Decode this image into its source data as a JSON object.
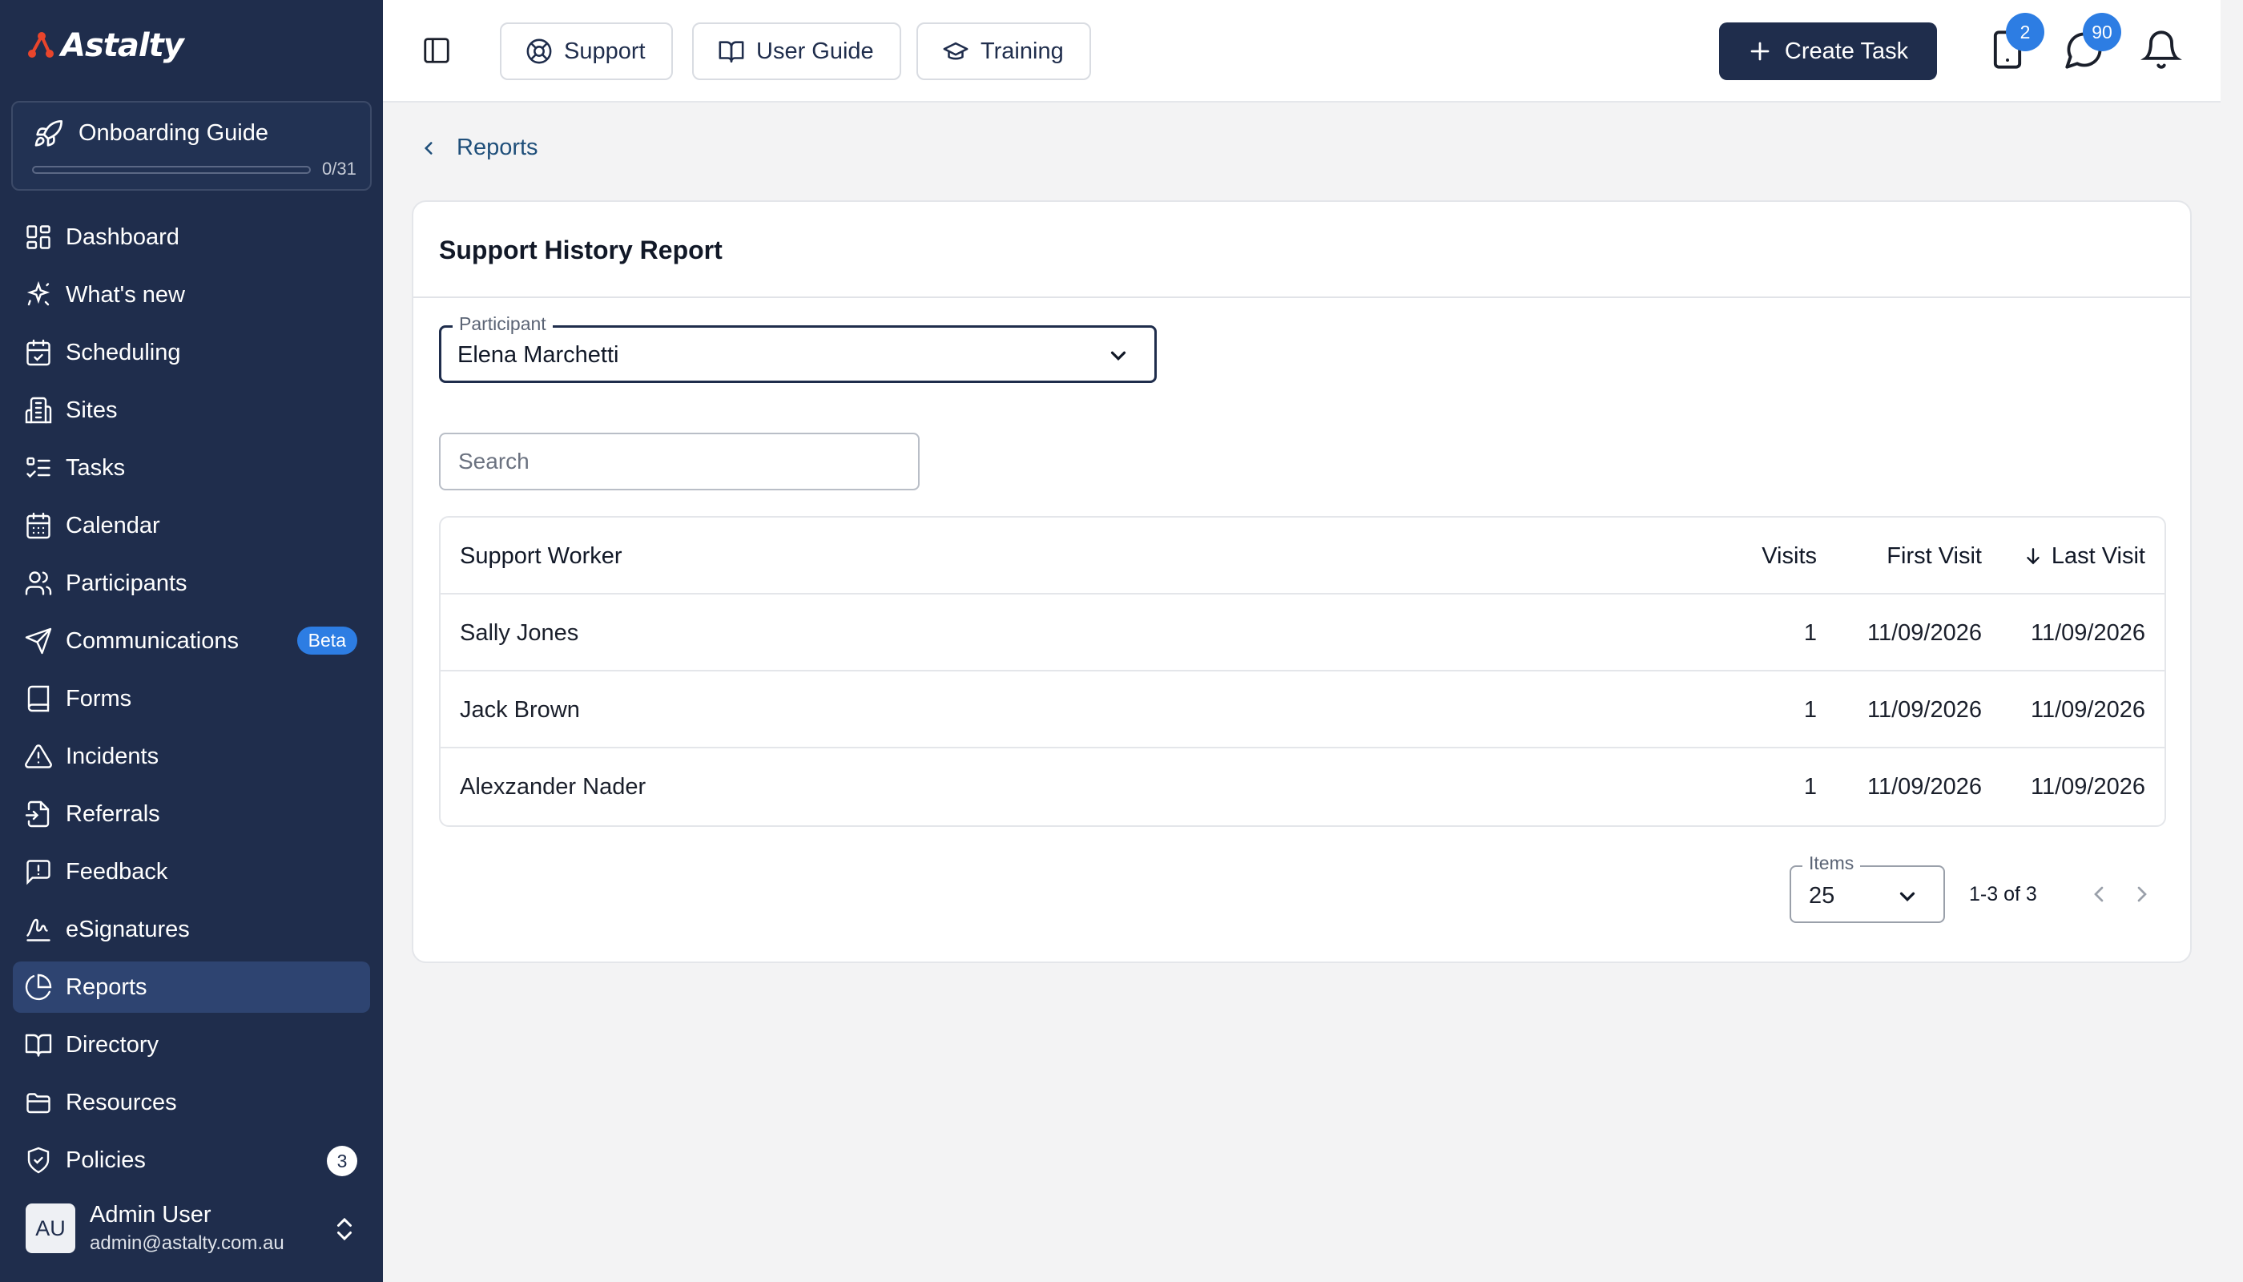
{
  "app": {
    "logo_text": "Astalty"
  },
  "onboarding": {
    "title": "Onboarding Guide",
    "progress_text": "0/31",
    "progress": 0
  },
  "sidebar": {
    "items": [
      {
        "label": "Dashboard",
        "icon": "dashboard-icon"
      },
      {
        "label": "What's new",
        "icon": "sparkle-icon"
      },
      {
        "label": "Scheduling",
        "icon": "calendar-check-icon"
      },
      {
        "label": "Sites",
        "icon": "building-icon"
      },
      {
        "label": "Tasks",
        "icon": "list-check-icon"
      },
      {
        "label": "Calendar",
        "icon": "calendar-icon"
      },
      {
        "label": "Participants",
        "icon": "users-icon"
      },
      {
        "label": "Communications",
        "icon": "send-icon",
        "badge": "Beta"
      },
      {
        "label": "Forms",
        "icon": "book-icon"
      },
      {
        "label": "Incidents",
        "icon": "warning-icon"
      },
      {
        "label": "Referrals",
        "icon": "referral-icon"
      },
      {
        "label": "Feedback",
        "icon": "feedback-icon"
      },
      {
        "label": "eSignatures",
        "icon": "signature-icon"
      },
      {
        "label": "Reports",
        "icon": "pie-chart-icon",
        "active": true
      },
      {
        "label": "Directory",
        "icon": "open-book-icon"
      },
      {
        "label": "Resources",
        "icon": "folder-icon"
      },
      {
        "label": "Policies",
        "icon": "shield-icon",
        "count": "3"
      }
    ]
  },
  "user": {
    "initials": "AU",
    "name": "Admin User",
    "email": "admin@astalty.com.au"
  },
  "topbar": {
    "support_label": "Support",
    "guide_label": "User Guide",
    "training_label": "Training",
    "create_label": "Create Task",
    "tablet_badge": "2",
    "messages_badge": "90"
  },
  "breadcrumb": {
    "back_label": "Reports"
  },
  "report": {
    "title": "Support History Report",
    "participant_label": "Participant",
    "participant_value": "Elena Marchetti",
    "search_placeholder": "Search",
    "columns": {
      "worker": "Support Worker",
      "visits": "Visits",
      "first": "First Visit",
      "last": "Last Visit"
    },
    "rows": [
      {
        "worker": "Sally Jones",
        "visits": "1",
        "first": "11/09/2026",
        "last": "11/09/2026"
      },
      {
        "worker": "Jack Brown",
        "visits": "1",
        "first": "11/09/2026",
        "last": "11/09/2026"
      },
      {
        "worker": "Alexzander Nader",
        "visits": "1",
        "first": "11/09/2026",
        "last": "11/09/2026"
      }
    ],
    "items_label": "Items",
    "items_value": "25",
    "range_text": "1-3 of 3"
  },
  "colors": {
    "sidebar": "#1f2d4c",
    "accent": "#2d7de3",
    "active": "#2e4471"
  }
}
